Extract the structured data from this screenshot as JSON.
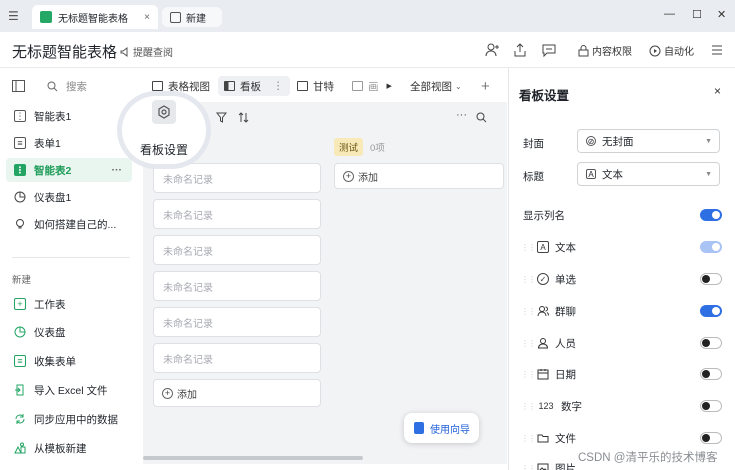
{
  "titlebar": {
    "tabs": [
      {
        "label": "无标题智能表格",
        "close": "×"
      },
      {
        "label": "新建"
      }
    ],
    "window_controls": {
      "minimize": "—",
      "maximize": "☐",
      "close": "✕"
    }
  },
  "header": {
    "title": "无标题智能表格",
    "remind_label": "提醒查阅",
    "permission_label": "内容权限",
    "automation_label": "自动化"
  },
  "sidebar": {
    "search_placeholder": "搜索",
    "items": [
      {
        "label": "智能表1",
        "icon": "grid-icon"
      },
      {
        "label": "表单1",
        "icon": "form-icon"
      },
      {
        "label": "智能表2",
        "icon": "grid-icon",
        "active": true,
        "more": "···"
      },
      {
        "label": "仪表盘1",
        "icon": "dashboard-icon"
      },
      {
        "label": "如何搭建自己的...",
        "icon": "bulb-icon"
      }
    ],
    "section_title": "新建",
    "new_items": [
      {
        "label": "工作表",
        "icon": "sheet-icon"
      },
      {
        "label": "仪表盘",
        "icon": "dashboard-icon"
      },
      {
        "label": "收集表单",
        "icon": "form-icon"
      },
      {
        "label": "导入 Excel 文件",
        "icon": "import-icon"
      },
      {
        "label": "同步应用中的数据",
        "icon": "sync-icon"
      },
      {
        "label": "从模板新建",
        "icon": "template-icon"
      }
    ]
  },
  "views": {
    "tabs": [
      {
        "label": "表格视图"
      },
      {
        "label": "看板",
        "active": true,
        "more": "⋮"
      },
      {
        "label": "甘特"
      },
      {
        "label": "画"
      }
    ],
    "all_views_label": "全部视图",
    "add_label": "+"
  },
  "board": {
    "spotlight_label": "看板设置",
    "columns": [
      {
        "tag": "",
        "cards": [
          "未命名记录",
          "未命名记录",
          "未命名记录",
          "未命名记录",
          "未命名记录",
          "未命名记录"
        ],
        "add_label": "添加"
      },
      {
        "tag": "测试",
        "count": "0项",
        "cards": [],
        "add_label": "添加"
      }
    ],
    "guide_label": "使用向导"
  },
  "panel": {
    "title": "看板设置",
    "close": "×",
    "cover_label": "封面",
    "cover_value": "无封面",
    "title_label": "标题",
    "title_value": "文本",
    "show_columns_label": "显示列名",
    "fields": [
      {
        "label": "文本",
        "icon": "text-icon",
        "state": "dim"
      },
      {
        "label": "单选",
        "icon": "select-icon",
        "state": "off"
      },
      {
        "label": "群聊",
        "icon": "group-icon",
        "state": "on"
      },
      {
        "label": "人员",
        "icon": "person-icon",
        "state": "off"
      },
      {
        "label": "日期",
        "icon": "calendar-icon",
        "state": "off"
      },
      {
        "label": "数字",
        "icon": "number-icon",
        "state": "off"
      },
      {
        "label": "文件",
        "icon": "folder-icon",
        "state": "off"
      },
      {
        "label": "图片",
        "icon": "image-icon",
        "state": "off"
      }
    ]
  },
  "watermark": "CSDN @清平乐的技术博客",
  "colors": {
    "accent": "#2f6fe4",
    "green": "#22a463"
  }
}
